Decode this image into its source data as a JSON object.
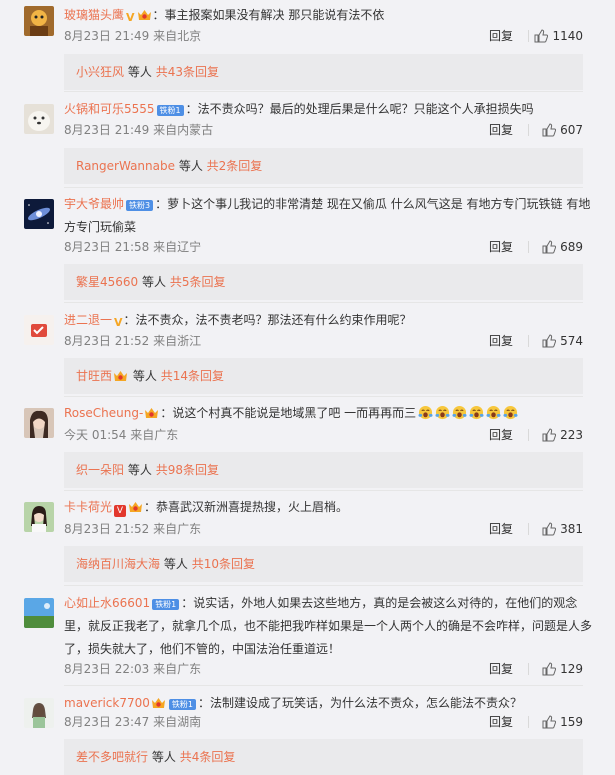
{
  "labels": {
    "reply": "回复"
  },
  "comments": [
    {
      "user": "玻璃猫头鹰",
      "text": "：事主报案如果没有解决 那只能说有法不依",
      "time": "8月23日 21:49 来自北京",
      "likes": "1140",
      "sub_user": "小兴狂风",
      "sub_suffix": "等人",
      "sub_count": "共43条回复"
    },
    {
      "user": "火锅和可乐5555",
      "tie": "铁粉1",
      "text": "：法不责众吗？最后的处理后果是什么呢？只能这个人承担损失吗",
      "time": "8月23日 21:49 来自内蒙古",
      "likes": "607",
      "sub_user": "RangerWannabe",
      "sub_suffix": "等人",
      "sub_count": "共2条回复"
    },
    {
      "user": "宇大爷最帅",
      "tie": "铁粉3",
      "text": "：萝卜这个事儿我记的非常清楚 现在又偷瓜 什么风气这是 有地方专门玩铁链 有地方专门玩偷菜",
      "time": "8月23日 21:58 来自辽宁",
      "likes": "689",
      "sub_user": "繁星45660",
      "sub_suffix": "等人",
      "sub_count": "共5条回复"
    },
    {
      "user": "进二退一",
      "text": "：法不责众，法不责老吗？那法还有什么约束作用呢？",
      "time": "8月23日 21:52 来自浙江",
      "likes": "574",
      "sub_user": "甘旺西",
      "sub_suffix": "等人",
      "sub_count": "共14条回复"
    },
    {
      "user": "RoseCheung-",
      "text": "：说这个村真不能说是地域黑了吧 一而再再而三",
      "time": "今天 01:54 来自广东",
      "likes": "223",
      "sub_user": "织一朵阳",
      "sub_suffix": "等人",
      "sub_count": "共98条回复"
    },
    {
      "user": "卡卡荷光",
      "text": "：恭喜武汉新洲喜提热搜，火上眉梢。",
      "time": "8月23日 21:52 来自广东",
      "likes": "381",
      "sub_user": "海纳百川海大海",
      "sub_suffix": "等人",
      "sub_count": "共10条回复"
    },
    {
      "user": "心如止水66601",
      "tie": "铁粉1",
      "text": "：说实话，外地人如果去这些地方，真的是会被这么对待的，在他们的观念里，就反正我老了，就拿几个瓜，也不能把我咋样如果是一个人两个人的确是不会咋样，问题是人多了，损失就大了，他们不管的，中国法治任重道远！",
      "time": "8月23日 22:03 来自广东",
      "likes": "129"
    },
    {
      "user": "maverick7700",
      "tie": "铁粉1",
      "text": "：法制建设成了玩笑话，为什么法不责众，怎么能法不责众？",
      "time": "8月23日 23:47 来自湖南",
      "likes": "159",
      "sub_user": "差不多吧就行",
      "sub_suffix": "等人",
      "sub_count": "共4条回复"
    }
  ],
  "colors": {
    "username": "#eb7350",
    "background": "#f2f2f5",
    "subreply_bg": "#eaeaec"
  },
  "icons": [
    "thumbs-up-icon",
    "vip-crown-icon",
    "verified-v-icon",
    "yawn-emoji-icon"
  ]
}
